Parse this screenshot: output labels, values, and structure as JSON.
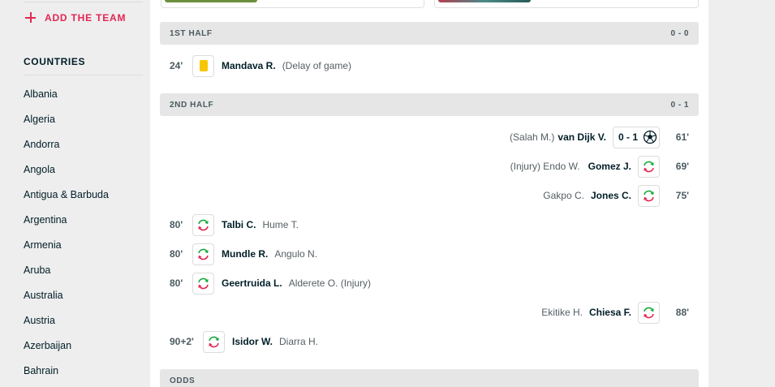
{
  "sidebar": {
    "add_team_label": "ADD THE TEAM",
    "countries_title": "COUNTRIES",
    "countries": [
      "Albania",
      "Algeria",
      "Andorra",
      "Angola",
      "Antigua & Barbuda",
      "Argentina",
      "Armenia",
      "Aruba",
      "Australia",
      "Austria",
      "Azerbaijan",
      "Bahrain"
    ]
  },
  "colors": {
    "accent": "#e32654",
    "yellow_card": "#f7c600",
    "sub_in": "#17a83a",
    "sub_out": "#e32654"
  },
  "first_half": {
    "label": "1ST HALF",
    "score": "0 - 0",
    "events": [
      {
        "minute": "24'",
        "icon": "yellow-card-icon",
        "player": "Mandava R.",
        "detail": "(Delay of game)"
      }
    ]
  },
  "second_half": {
    "label": "2ND HALF",
    "score": "0 - 1",
    "goal": {
      "minute": "61'",
      "assist": "(Salah M.)",
      "player": "van Dijk V.",
      "score": "0 - 1",
      "icon": "soccer-ball-icon"
    },
    "sub_gomez": {
      "minute": "69'",
      "out": "(Injury) Endo W.",
      "player": "Gomez J.",
      "icon": "substitution-icon"
    },
    "sub_jones": {
      "minute": "75'",
      "out": "Gakpo C.",
      "player": "Jones C.",
      "icon": "substitution-icon"
    },
    "sub_talbi": {
      "minute": "80'",
      "player": "Talbi C.",
      "out": "Hume T.",
      "icon": "substitution-icon"
    },
    "sub_mundle": {
      "minute": "80'",
      "player": "Mundle R.",
      "out": "Angulo N.",
      "icon": "substitution-icon"
    },
    "sub_geertruida": {
      "minute": "80'",
      "player": "Geertruida L.",
      "out": "Alderete O. (Injury)",
      "icon": "substitution-icon"
    },
    "sub_chiesa": {
      "minute": "88'",
      "out": "Ekitike H.",
      "player": "Chiesa F.",
      "icon": "substitution-icon"
    },
    "sub_isidor": {
      "minute": "90+2'",
      "player": "Isidor W.",
      "out": "Diarra H.",
      "icon": "substitution-icon"
    }
  },
  "odds": {
    "label": "ODDS"
  }
}
